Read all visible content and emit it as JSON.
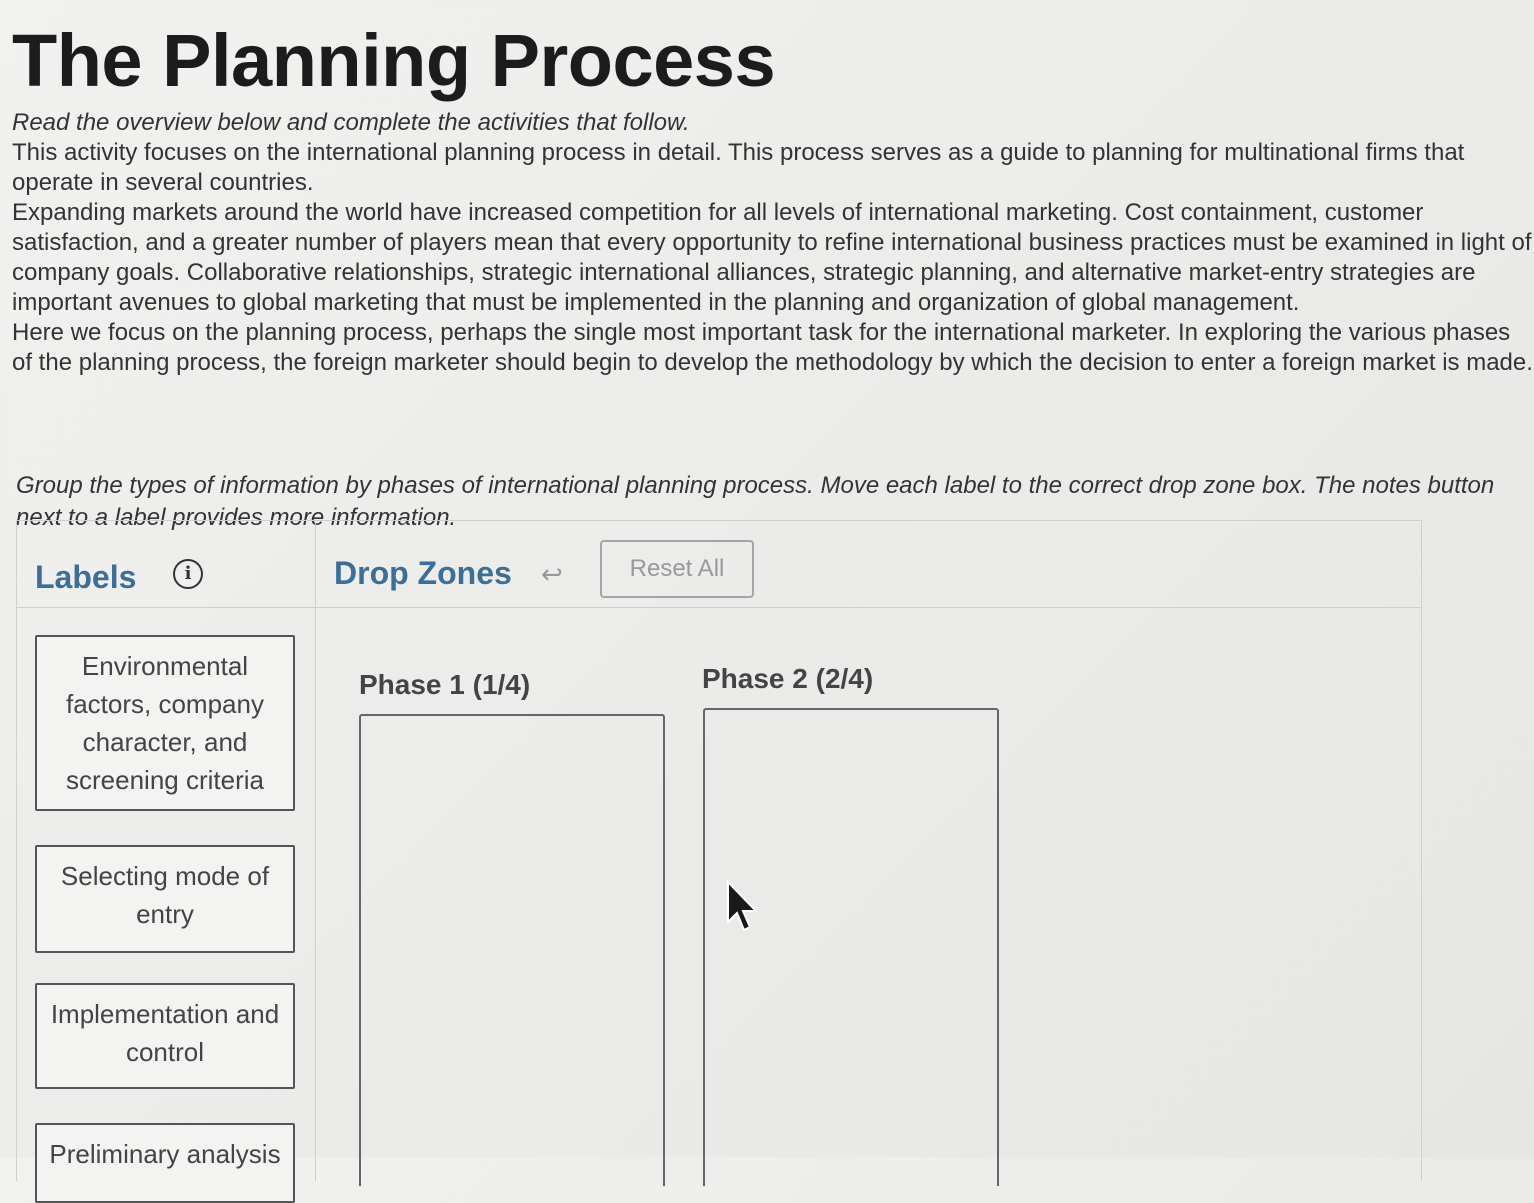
{
  "page": {
    "title": "The Planning Process",
    "intro_italic": "Read the overview below and complete the activities that follow.",
    "paragraphs": [
      "This activity focuses on the international planning process in detail. This process serves as a guide to planning for multinational firms that operate in several countries.",
      "Expanding markets around the world have increased competition for all levels of international marketing. Cost containment, customer satisfaction, and a greater number of players mean that every opportunity to refine international business practices must be examined in light of company goals. Collaborative relationships, strategic international alliances, strategic planning, and alternative market-entry strategies are important avenues to global marketing that must be implemented in the planning and organization of global management.",
      "Here we focus on the planning process, perhaps the single most important task for the international marketer. In exploring the various phases of the planning process, the foreign marketer should begin to develop the methodology by which the decision to enter a foreign market is made."
    ],
    "instructions": "Group the types of information by phases of international planning process. Move each label to the correct drop zone box. The notes button next to a label provides more information."
  },
  "labels_panel": {
    "title": "Labels",
    "info_icon": "info-icon",
    "items": [
      {
        "text": "Environmental factors, company character, and screening criteria"
      },
      {
        "text": "Selecting mode of entry"
      },
      {
        "text": "Implementation and control"
      },
      {
        "text": "Preliminary analysis"
      }
    ]
  },
  "drop_zones": {
    "title": "Drop Zones",
    "undo_icon": "undo-arrow-icon",
    "reset_label": "Reset All",
    "zones": [
      {
        "title": "Phase 1 (1/4)"
      },
      {
        "title": "Phase 2 (2/4)"
      }
    ]
  },
  "colors": {
    "heading_accent": "#3d6e97",
    "background": "#ecebe9"
  }
}
